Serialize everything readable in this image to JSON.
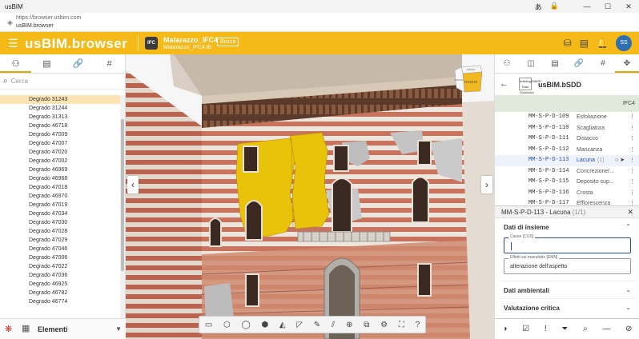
{
  "window": {
    "title": "usBIM",
    "controls": [
      "—",
      "☐",
      "✕"
    ]
  },
  "browser": {
    "url": "https://browser.usbim.com",
    "host": "usBIM.browser"
  },
  "app": {
    "logo": "usBIM.browser",
    "model_name": "Matarazzo_IFC4",
    "model_sub": "Matarazzo_IFC4.ifc",
    "draft_label": "Bozza",
    "avatar": "SS",
    "ifc_badge": "IFC"
  },
  "left_panel": {
    "search_placeholder": "Cerca",
    "items": [
      "Degrado 31243",
      "Degrado 31244",
      "Degrado 31313",
      "Degrado 46718",
      "Degrado 47009",
      "Degrado 47007",
      "Degrado 47020",
      "Degrado 47002",
      "Degrado 46969",
      "Degrado 46968",
      "Degrado 47018",
      "Degrado 46970",
      "Degrado 47019",
      "Degrado 47034",
      "Degrado 47030",
      "Degrado 47028",
      "Degrado 47029",
      "Degrado 47046",
      "Degrado 47006",
      "Degrado 47022",
      "Degrado 47036",
      "Degrado 46925",
      "Degrado 46782",
      "Degrado 46774"
    ],
    "selected_index": 0,
    "footer_label": "Elementi"
  },
  "viewport": {
    "cube_top": "SOPRA",
    "cube_front": "FRONTE",
    "cube_left": "SINISTRA"
  },
  "right_panel": {
    "title": "usBIM.bSDD",
    "bsdd_label": "buildingSMART Data Dictionary",
    "version": "IFC4",
    "rows": [
      {
        "code": "MM-S-P-D-109",
        "name": "Esfoliazione",
        "count": ""
      },
      {
        "code": "MM-S-P-D-110",
        "name": "Scagliatura",
        "count": ""
      },
      {
        "code": "MM-S-P-D-111",
        "name": "Distacco",
        "count": ""
      },
      {
        "code": "MM-S-P-D-112",
        "name": "Mancanza",
        "count": ""
      },
      {
        "code": "MM-S-P-D-113",
        "name": "Lacuna",
        "count": "(1)"
      },
      {
        "code": "MM-S-P-D-114",
        "name": "Concrezione/...",
        "count": ""
      },
      {
        "code": "MM-S-P-D-115",
        "name": "Deposito sup...",
        "count": ""
      },
      {
        "code": "MM-S-P-D-116",
        "name": "Crosta",
        "count": ""
      },
      {
        "code": "MM-S-P-D-117",
        "name": "Efflorescenza",
        "count": ""
      }
    ],
    "selected_row": 4,
    "detail": {
      "title": "MM-S-P-D-113 - Lacuna",
      "count": "(1/1)",
      "section1": "Dati di insieme",
      "field1_label": "Cause [CUS]",
      "field1_value": "",
      "field2_label": "Effetti sui manufatto [EMN]",
      "field2_value": "alterazione dell'aspetto",
      "section2": "Dati ambientali",
      "section3": "Valutazione critica"
    }
  },
  "colors": {
    "accent": "#f5b918",
    "selection": "#fce3b3",
    "band": "#dfe9dc",
    "highlight": "#f0c800"
  }
}
